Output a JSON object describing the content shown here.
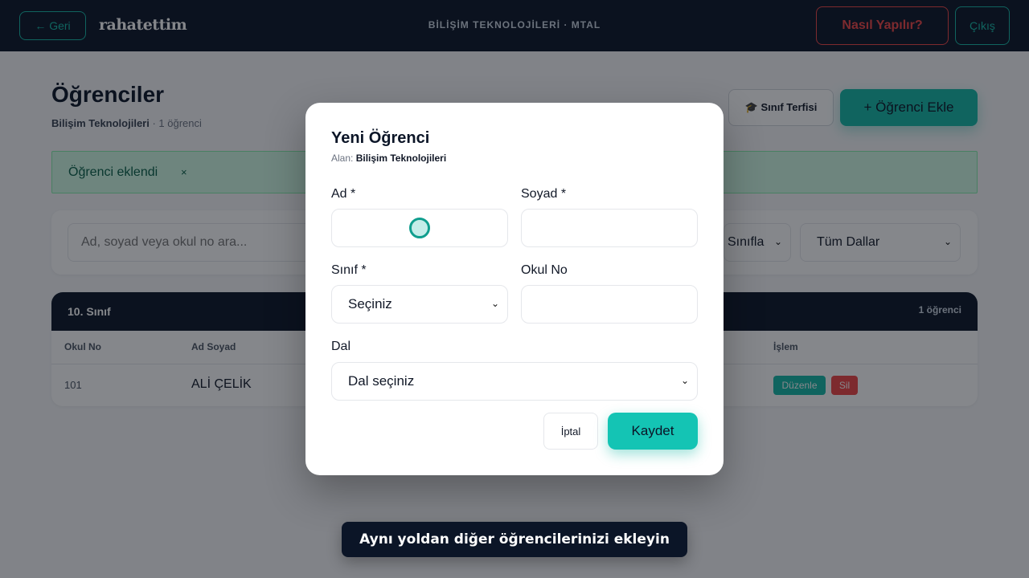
{
  "topbar": {
    "back_label": "← Geri",
    "logo": "rahatettim",
    "center_text": "BİLİŞİM TEKNOLOJİLERİ · MTAL",
    "howto_label": "Nasıl Yapılır?",
    "logout_label": "Çıkış"
  },
  "page": {
    "title": "Öğrenciler",
    "sub_area": "Bilişim Teknolojileri",
    "sub_count": " · 1 öğrenci",
    "promote_label": "🎓 Sınıf Terfisi",
    "add_label": "+ Öğrenci Ekle"
  },
  "alert": {
    "text": "Öğrenci eklendi",
    "close": "×"
  },
  "filters": {
    "search_placeholder": "Ad, soyad veya okul no ara...",
    "class_value": "Sınıfla",
    "branch_value": "Tüm Dallar"
  },
  "table": {
    "group_title": "10. Sınıf",
    "group_count": "1 öğrenci",
    "columns": [
      "Okul No",
      "Ad Soyad",
      "İşlem"
    ],
    "rows": [
      {
        "no": "101",
        "name": "ALİ ÇELİK",
        "edit": "Düzenle",
        "delete": "Sil"
      }
    ]
  },
  "modal": {
    "title": "Yeni Öğrenci",
    "area_prefix": "Alan: ",
    "area_value": "Bilişim Teknolojileri",
    "first_name_label": "Ad *",
    "last_name_label": "Soyad *",
    "class_label": "Sınıf *",
    "class_value": "Seçiniz",
    "school_no_label": "Okul No",
    "branch_label": "Dal",
    "branch_value": "Dal seçiniz",
    "cancel_label": "İptal",
    "save_label": "Kaydet"
  },
  "toast": {
    "text": "Aynı yoldan diğer öğrencilerinizi ekleyin"
  }
}
